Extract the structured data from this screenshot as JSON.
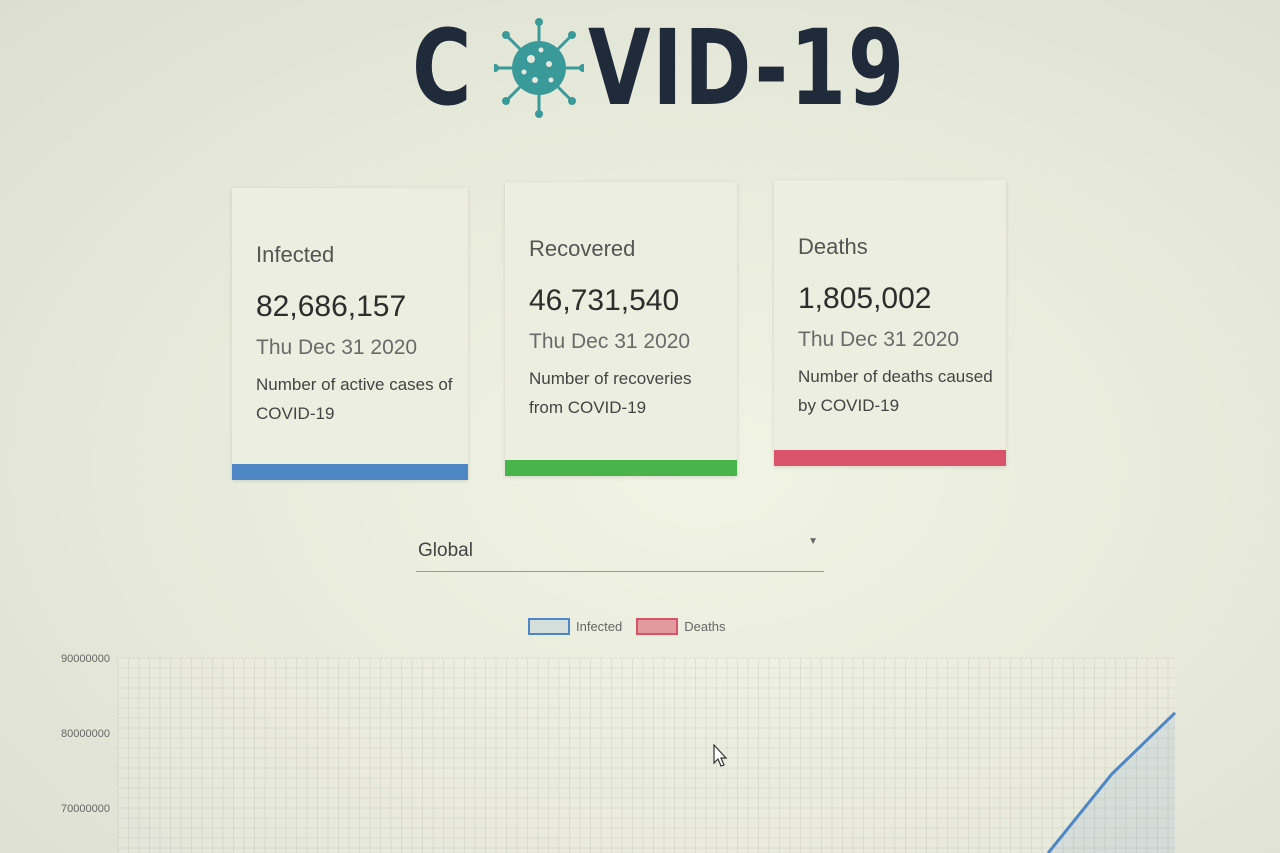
{
  "header": {
    "logo_prefix": "C",
    "logo_suffix": "VID-19"
  },
  "cards": [
    {
      "label": "Infected",
      "value": "82,686,157",
      "date": "Thu Dec 31 2020",
      "description": "Number of active cases of COVID-19",
      "color": "#4f86c6"
    },
    {
      "label": "Recovered",
      "value": "46,731,540",
      "date": "Thu Dec 31 2020",
      "description": "Number of recoveries from COVID-19",
      "color": "#49b34c"
    },
    {
      "label": "Deaths",
      "value": "1,805,002",
      "date": "Thu Dec 31 2020",
      "description": "Number of deaths caused by COVID-19",
      "color": "#d9546a"
    }
  ],
  "country_select": {
    "selected": "Global"
  },
  "chart_data": {
    "type": "line",
    "legend": [
      "Infected",
      "Deaths"
    ],
    "series": [
      {
        "name": "Infected",
        "color": "#4f86c6",
        "x_fraction": [
          0.88,
          0.94,
          1.0
        ],
        "values": [
          64000000,
          74500000,
          82686157
        ]
      },
      {
        "name": "Deaths",
        "color": "#d9546a",
        "values": []
      }
    ],
    "yticks": [
      "90000000",
      "80000000",
      "70000000"
    ],
    "ylim_visible": [
      64000000,
      90000000
    ],
    "grid": true
  }
}
